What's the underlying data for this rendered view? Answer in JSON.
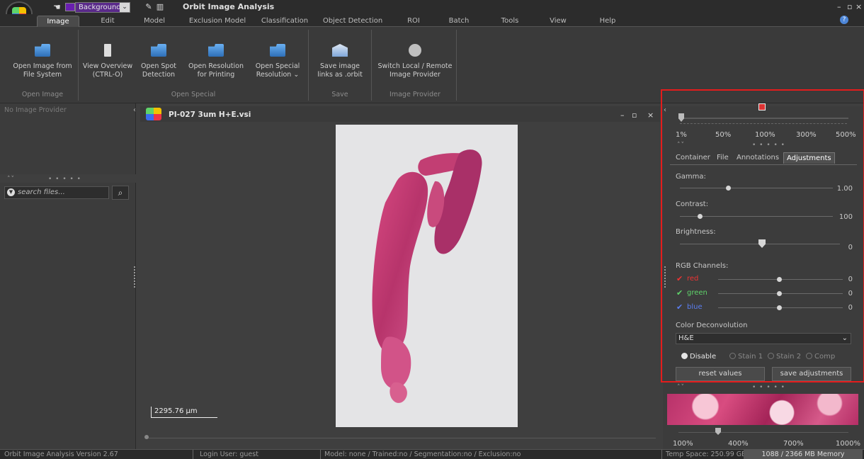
{
  "titlebar": {
    "layer_combo": "Background",
    "app_title": "Orbit Image Analysis",
    "minimize": "–",
    "maximize": "▫",
    "close": "×"
  },
  "tabs": [
    {
      "label": "Image",
      "active": true
    },
    {
      "label": "Edit"
    },
    {
      "label": "Model"
    },
    {
      "label": "Exclusion Model"
    },
    {
      "label": "Classification"
    },
    {
      "label": "Object Detection"
    },
    {
      "label": "ROI"
    },
    {
      "label": "Batch"
    },
    {
      "label": "Tools"
    },
    {
      "label": "View"
    },
    {
      "label": "Help"
    }
  ],
  "ribbon": {
    "buttons": [
      {
        "line1": "Open Image from",
        "line2": "File System"
      },
      {
        "line1": "View Overview",
        "line2": "(CTRL-O)"
      },
      {
        "line1": "Open Spot",
        "line2": "Detection"
      },
      {
        "line1": "Open Resolution",
        "line2": "for Printing"
      },
      {
        "line1": "Open Special",
        "line2": "Resolution ⌄"
      },
      {
        "line1": "Save image",
        "line2": "links as .orbit"
      },
      {
        "line1": "Switch Local / Remote",
        "line2": "Image Provider"
      }
    ],
    "groups": [
      "Open Image",
      "Open Special",
      "Save",
      "Image Provider"
    ]
  },
  "left_panel": {
    "provider_text": "No Image Provider",
    "search_placeholder": "search files...",
    "search_icon": "magnifier-icon",
    "dots": "• • • • •"
  },
  "viewer": {
    "title": "PI-027 3um H+E.vsi",
    "scale_label": "2295.76 µm",
    "min": "–",
    "restore": "▫",
    "close": "×"
  },
  "right_panel": {
    "zoom_labels": [
      "1%",
      "50%",
      "100%",
      "300%",
      "500%"
    ],
    "zoom_level": 0.0,
    "tabs": [
      {
        "label": "Container"
      },
      {
        "label": "File"
      },
      {
        "label": "Annotations"
      },
      {
        "label": "Adjustments",
        "active": true
      }
    ],
    "gamma": {
      "label": "Gamma:",
      "value": "1.00",
      "position": 0.3
    },
    "contrast": {
      "label": "Contrast:",
      "value": "100",
      "position": 0.12
    },
    "brightness": {
      "label": "Brightness:",
      "value": "0",
      "position": 0.5
    },
    "rgb": {
      "label": "RGB Channels:",
      "channels": [
        {
          "name": "red",
          "value": "0",
          "position": 0.5
        },
        {
          "name": "green",
          "value": "0",
          "position": 0.5
        },
        {
          "name": "blue",
          "value": "0",
          "position": 0.5
        }
      ]
    },
    "deconv": {
      "label": "Color Deconvolution",
      "selected": "H&E"
    },
    "radios": [
      {
        "label": "Disable",
        "selected": true
      },
      {
        "label": "Stain 1"
      },
      {
        "label": "Stain 2"
      },
      {
        "label": "Comp"
      }
    ],
    "reset_button": "reset values",
    "save_button": "save adjustments",
    "thumb_zoom_labels": [
      "100%",
      "400%",
      "700%",
      "1000%"
    ],
    "dots": "• • • • •"
  },
  "status": {
    "version": "Orbit Image Analysis Version 2.67",
    "login": "Login User: guest",
    "model": "Model: none / Trained:no / Segmentation:no / Exclusion:no",
    "temp": "Temp Space: 250.99 GB",
    "memory": "1088 / 2366 MB Memory"
  },
  "colors": {
    "highlight": "#e41c1c",
    "layer_swatch": "#6a1fb0",
    "tissue": "#c93a72"
  }
}
